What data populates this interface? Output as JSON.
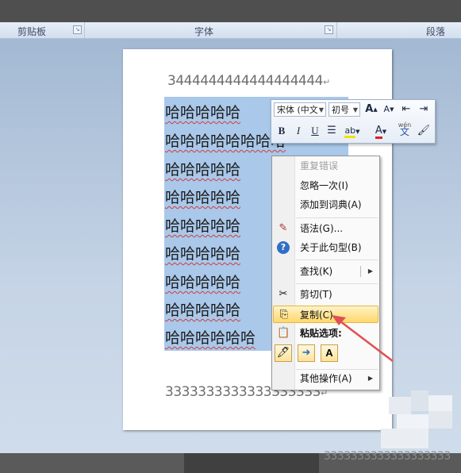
{
  "ribbon": {
    "groups": [
      "剪贴板",
      "字体",
      "段落"
    ]
  },
  "document": {
    "first_line": "3444444444444444444",
    "haha_lines": [
      "哈哈哈哈哈",
      "哈哈哈哈哈哈哈哈",
      "哈哈哈哈哈",
      "哈哈哈哈哈",
      "哈哈哈哈哈",
      "哈哈哈哈哈",
      "哈哈哈哈哈",
      "哈哈哈哈哈",
      "哈哈哈哈哈哈"
    ],
    "last_line": "3333333333333333333",
    "footer_fragment": "3333333333333333333",
    "para_mark": "↵"
  },
  "mini_toolbar": {
    "font_name": "宋体 (中文",
    "font_size": "初号",
    "bold": "B",
    "italic": "I",
    "underline": "U",
    "grow_font": "A",
    "shrink_font": "A",
    "font_color": "A",
    "phonetic": "wén",
    "phonetic_char": "文"
  },
  "context_menu": {
    "items": {
      "repeat": "重复错误",
      "ignore_once": "忽略一次(I)",
      "add_dict": "添加到词典(A)",
      "grammar": "语法(G)...",
      "about_sentence": "关于此句型(B)",
      "find": "查找(K)",
      "cut": "剪切(T)",
      "copy": "复制(C)",
      "paste_options": "粘贴选项:",
      "more": "其他操作(A)"
    }
  },
  "colors": {
    "selection": "#a9c8ea",
    "highlight": "#ffd86b",
    "arrow": "#e05050"
  }
}
